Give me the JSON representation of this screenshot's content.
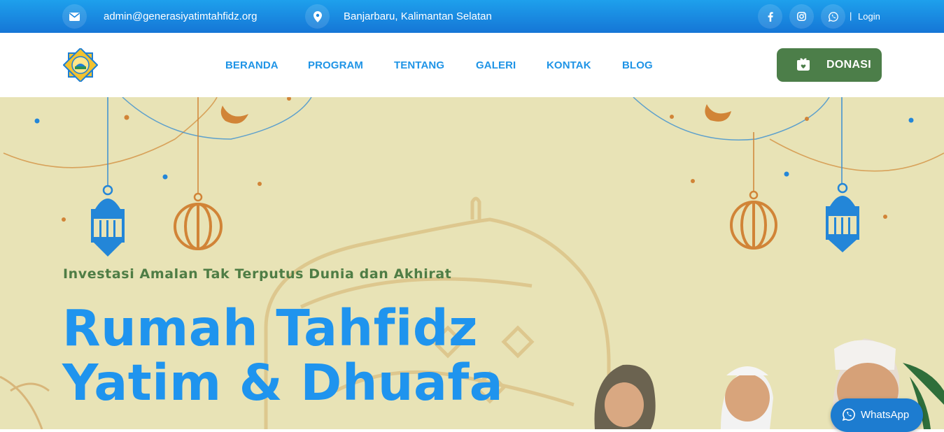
{
  "topbar": {
    "email": "admin@generasiyatimtahfidz.org",
    "location": "Banjarbaru, Kalimantan Selatan",
    "separator": "|",
    "login_label": "Login",
    "icons": [
      "envelope-icon",
      "map-pin-icon",
      "facebook-icon",
      "instagram-icon",
      "whatsapp-icon"
    ]
  },
  "header": {
    "nav": [
      "BERANDA",
      "PROGRAM",
      "TENTANG",
      "GALERI",
      "KONTAK",
      "BLOG"
    ],
    "donate_label": "DONASI"
  },
  "hero": {
    "tagline": "Investasi Amalan Tak Terputus Dunia dan Akhirat",
    "headline_line1": "Rumah Tahfidz",
    "headline_line2": "Yatim & Dhuafa"
  },
  "whatsapp_float": {
    "label": "WhatsApp"
  },
  "colors": {
    "topbar": "#1a8ae3",
    "nav_text": "#1f94e6",
    "donate_bg": "#4c7e49",
    "hero_bg": "#e8e3b6",
    "headline": "#1f94ee",
    "tagline": "#4f7d45",
    "whatsapp_bg": "#1d7cd0"
  }
}
